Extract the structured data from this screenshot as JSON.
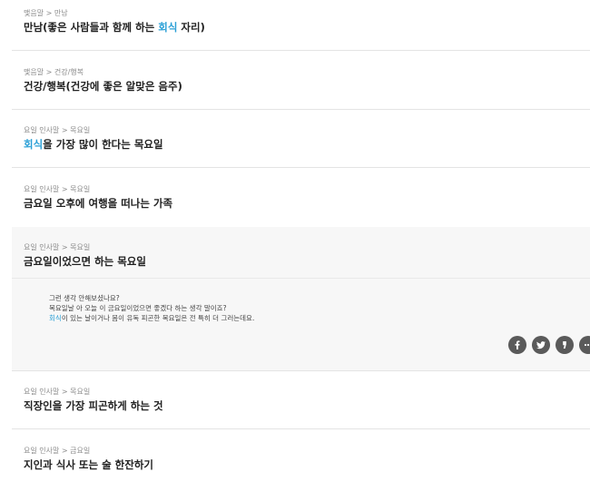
{
  "items": [
    {
      "crumb": "맺음말 > 만남",
      "title_pre": "만남(좋은 사람들과 함께 하는 ",
      "title_hl": "회식",
      "title_post": " 자리)"
    },
    {
      "crumb": "맺음말 > 건강/행복",
      "title_pre": "건강/행복(건강에 좋은 알맞은 음주)",
      "title_hl": "",
      "title_post": ""
    },
    {
      "crumb": "요일 인사말 > 목요일",
      "title_pre": "",
      "title_hl": "회식",
      "title_post": "을 가장 많이 한다는 목요일"
    },
    {
      "crumb": "요일 인사말 > 목요일",
      "title_pre": "금요일 오후에 여행을 떠나는 가족",
      "title_hl": "",
      "title_post": ""
    },
    {
      "crumb": "요일 인사말 > 목요일",
      "title_pre": "금요일이었으면 하는 목요일",
      "title_hl": "",
      "title_post": ""
    },
    {
      "crumb": "요일 인사말 > 목요일",
      "title_pre": "직장인을 가장 피곤하게 하는 것",
      "title_hl": "",
      "title_post": ""
    },
    {
      "crumb": "요일 인사말 > 금요일",
      "title_pre": "지인과 식사 또는 술 한잔하기",
      "title_hl": "",
      "title_post": ""
    }
  ],
  "detail": {
    "line1": "그런 생각 안해보셨나요?",
    "line2": "목요일날 아 오늘 이 금요일이었으면 좋겠다 하는 생각 말이죠?",
    "line3_hl": "회식",
    "line3_rest": "이 있는 날이거나 몸이 유독 피곤한 목요일은 전 특히 더 그러는데요."
  },
  "share": [
    {
      "icon": "facebook-icon"
    },
    {
      "icon": "twitter-icon"
    },
    {
      "icon": "kakaostory-icon"
    },
    {
      "icon": "more-share-icon"
    }
  ],
  "colors": {
    "highlight": "#2a9fd6",
    "title": "#222222",
    "crumb": "#8a8a8a",
    "expanded_bg": "#f7f7f7",
    "share_btn": "#5a5a5a"
  }
}
